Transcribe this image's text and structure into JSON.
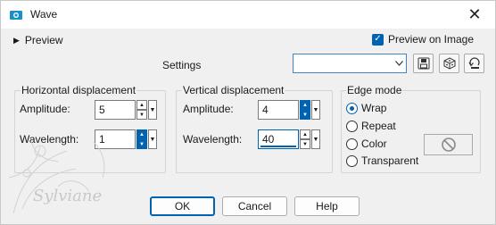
{
  "window": {
    "title": "Wave",
    "close_glyph": "✕",
    "icon": "wave-app-icon"
  },
  "preview": {
    "toggle_label": "Preview",
    "preview_on_image_label": "Preview on Image",
    "preview_on_image_checked": true
  },
  "settings": {
    "label": "Settings",
    "value": "",
    "buttons": [
      "save-preset-icon",
      "randomize-icon",
      "reset-icon"
    ]
  },
  "horizontal": {
    "title": "Horizontal displacement",
    "amplitude_label": "Amplitude:",
    "amplitude_value": "5",
    "wavelength_label": "Wavelength:",
    "wavelength_value": "1"
  },
  "vertical": {
    "title": "Vertical displacement",
    "amplitude_label": "Amplitude:",
    "amplitude_value": "4",
    "wavelength_label": "Wavelength:",
    "wavelength_value": "40"
  },
  "edge_mode": {
    "title": "Edge mode",
    "options": [
      {
        "label": "Wrap",
        "selected": true
      },
      {
        "label": "Repeat",
        "selected": false
      },
      {
        "label": "Color",
        "selected": false
      },
      {
        "label": "Transparent",
        "selected": false
      }
    ]
  },
  "buttons": {
    "ok": "OK",
    "cancel": "Cancel",
    "help": "Help"
  },
  "watermark": {
    "text": "Sylviane"
  },
  "colors": {
    "accent": "#0063b1",
    "background": "#f0f0f0"
  }
}
